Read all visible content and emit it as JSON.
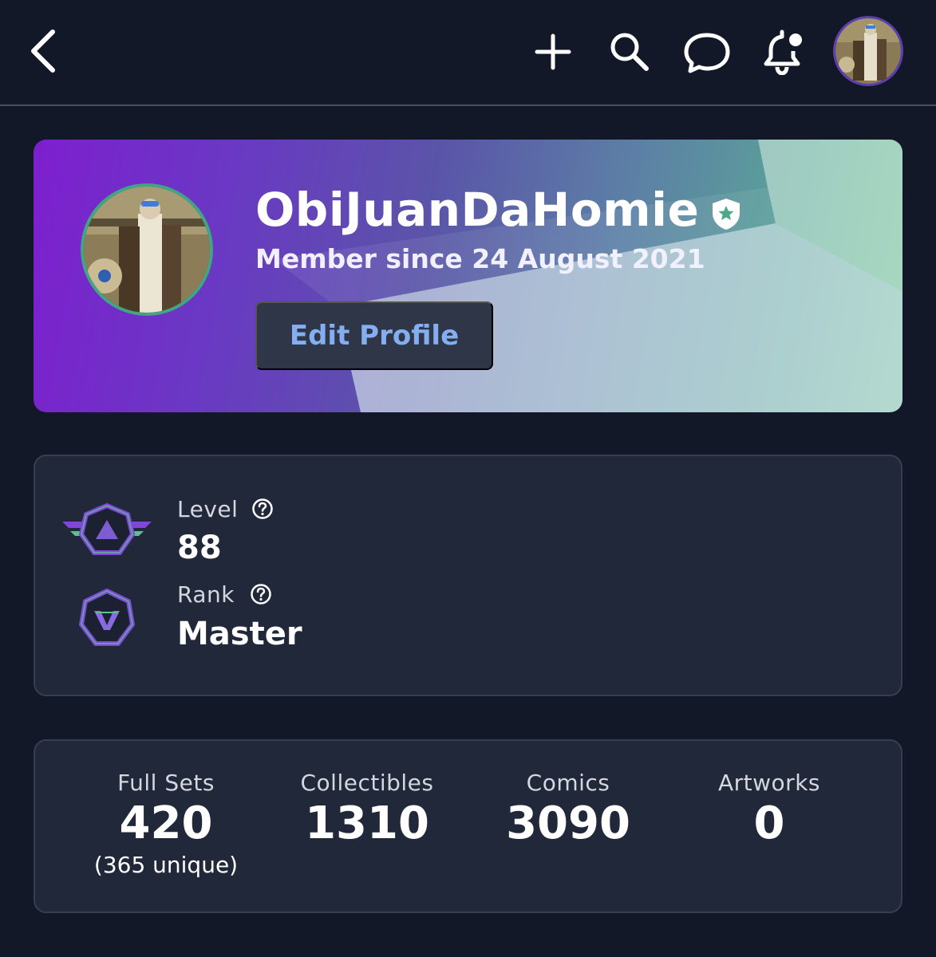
{
  "topbar": {
    "icons": [
      "back-icon",
      "plus-icon",
      "search-icon",
      "chat-icon",
      "bell-icon",
      "avatar"
    ]
  },
  "profile": {
    "username": "ObiJuanDaHomie",
    "member_since": "Member since 24 August 2021",
    "edit_label": "Edit Profile"
  },
  "progress": {
    "level_label": "Level",
    "level_value": "88",
    "rank_label": "Rank",
    "rank_value": "Master"
  },
  "stats": [
    {
      "label": "Full Sets",
      "value": "420",
      "sub": "(365 unique)"
    },
    {
      "label": "Collectibles",
      "value": "1310",
      "sub": ""
    },
    {
      "label": "Comics",
      "value": "3090",
      "sub": ""
    },
    {
      "label": "Artworks",
      "value": "0",
      "sub": ""
    }
  ],
  "colors": {
    "background": "#131828",
    "card": "#212839",
    "accent_blue": "#84aef0",
    "banner_purple": "#7d1fcf",
    "banner_green": "#6fc197"
  }
}
